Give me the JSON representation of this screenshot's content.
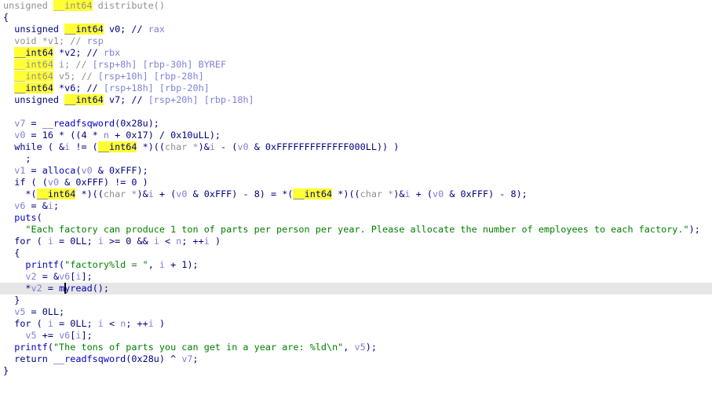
{
  "view": "pseudocode",
  "current_line": 24,
  "colors": {
    "code": "#000080",
    "variable": "#8080d8",
    "string": "#008000",
    "function": "#0000c0",
    "highlight": "#ffff33",
    "current_line": "#e6e6e6"
  },
  "lines": [
    {
      "indent": 0,
      "tokens": [
        [
          "g",
          "unsigned "
        ],
        [
          "hg",
          "__int64"
        ],
        [
          "g",
          " distribute()"
        ]
      ]
    },
    {
      "indent": 0,
      "tokens": [
        [
          "n",
          "{"
        ]
      ]
    },
    {
      "indent": 1,
      "tokens": [
        [
          "n",
          "unsigned "
        ],
        [
          "h",
          "__int64"
        ],
        [
          "n",
          " v0; // "
        ],
        [
          "v",
          "rax"
        ]
      ]
    },
    {
      "indent": 1,
      "tokens": [
        [
          "g",
          "void *v1; // "
        ],
        [
          "v",
          "rsp"
        ]
      ]
    },
    {
      "indent": 1,
      "tokens": [
        [
          "h",
          "__int64"
        ],
        [
          "n",
          " *v2; // "
        ],
        [
          "v",
          "rbx"
        ]
      ]
    },
    {
      "indent": 1,
      "tokens": [
        [
          "hg",
          "__int64"
        ],
        [
          "g",
          " i; // "
        ],
        [
          "v",
          "[rsp+8h] [rbp-30h] BYREF"
        ]
      ]
    },
    {
      "indent": 1,
      "tokens": [
        [
          "hg",
          "__int64"
        ],
        [
          "g",
          " v5; // "
        ],
        [
          "v",
          "[rsp+10h] [rbp-28h]"
        ]
      ]
    },
    {
      "indent": 1,
      "tokens": [
        [
          "h",
          "__int64"
        ],
        [
          "n",
          " *v6; // "
        ],
        [
          "v",
          "[rsp+18h] [rbp-20h]"
        ]
      ]
    },
    {
      "indent": 1,
      "tokens": [
        [
          "n",
          "unsigned "
        ],
        [
          "h",
          "__int64"
        ],
        [
          "n",
          " v7; // "
        ],
        [
          "v",
          "[rsp+20h] [rbp-18h]"
        ]
      ]
    },
    {
      "indent": 0,
      "tokens": []
    },
    {
      "indent": 1,
      "tokens": [
        [
          "v",
          "v7"
        ],
        [
          "n",
          " = "
        ],
        [
          "f",
          "__readfsqword"
        ],
        [
          "n",
          "(0x28u);"
        ]
      ]
    },
    {
      "indent": 1,
      "tokens": [
        [
          "v",
          "v0"
        ],
        [
          "n",
          " = 16 * ((4 * "
        ],
        [
          "v",
          "n"
        ],
        [
          "n",
          " + 0x17) / 0x10uLL);"
        ]
      ]
    },
    {
      "indent": 1,
      "tokens": [
        [
          "n",
          "while ( &"
        ],
        [
          "v",
          "i"
        ],
        [
          "n",
          " != ("
        ],
        [
          "h",
          "__int64"
        ],
        [
          "n",
          " *)(("
        ],
        [
          "g",
          "char *"
        ],
        [
          "n",
          ")&"
        ],
        [
          "v",
          "i"
        ],
        [
          "n",
          " - ("
        ],
        [
          "v",
          "v0"
        ],
        [
          "n",
          " & 0xFFFFFFFFFFFFF000LL)) )"
        ]
      ]
    },
    {
      "indent": 2,
      "tokens": [
        [
          "n",
          ";"
        ]
      ]
    },
    {
      "indent": 1,
      "tokens": [
        [
          "v",
          "v1"
        ],
        [
          "n",
          " = "
        ],
        [
          "f",
          "alloca"
        ],
        [
          "n",
          "("
        ],
        [
          "v",
          "v0"
        ],
        [
          "n",
          " & 0xFFF);"
        ]
      ]
    },
    {
      "indent": 1,
      "tokens": [
        [
          "n",
          "if ( ("
        ],
        [
          "v",
          "v0"
        ],
        [
          "n",
          " & 0xFFF) != 0 )"
        ]
      ]
    },
    {
      "indent": 2,
      "tokens": [
        [
          "n",
          "*("
        ],
        [
          "h",
          "__int64"
        ],
        [
          "n",
          " *)(("
        ],
        [
          "g",
          "char *"
        ],
        [
          "n",
          ")&"
        ],
        [
          "v",
          "i"
        ],
        [
          "n",
          " + ("
        ],
        [
          "v",
          "v0"
        ],
        [
          "n",
          " & 0xFFF) - 8) = *("
        ],
        [
          "h",
          "__int64"
        ],
        [
          "n",
          " *)(("
        ],
        [
          "g",
          "char *"
        ],
        [
          "n",
          ")&"
        ],
        [
          "v",
          "i"
        ],
        [
          "n",
          " + ("
        ],
        [
          "v",
          "v0"
        ],
        [
          "n",
          " & 0xFFF) - 8);"
        ]
      ]
    },
    {
      "indent": 1,
      "tokens": [
        [
          "v",
          "v6"
        ],
        [
          "n",
          " = &"
        ],
        [
          "v",
          "i"
        ],
        [
          "n",
          ";"
        ]
      ]
    },
    {
      "indent": 1,
      "tokens": [
        [
          "f",
          "puts"
        ],
        [
          "n",
          "("
        ]
      ]
    },
    {
      "indent": 2,
      "tokens": [
        [
          "s",
          "\"Each factory can produce 1 ton of parts per person per year. Please allocate the number of employees to each factory.\""
        ],
        [
          "n",
          ");"
        ]
      ]
    },
    {
      "indent": 1,
      "tokens": [
        [
          "n",
          "for ( "
        ],
        [
          "v",
          "i"
        ],
        [
          "n",
          " = 0LL; "
        ],
        [
          "v",
          "i"
        ],
        [
          "n",
          " >= 0 && "
        ],
        [
          "v",
          "i"
        ],
        [
          "n",
          " < "
        ],
        [
          "v",
          "n"
        ],
        [
          "n",
          "; ++"
        ],
        [
          "v",
          "i"
        ],
        [
          "n",
          " )"
        ]
      ]
    },
    {
      "indent": 1,
      "tokens": [
        [
          "n",
          "{"
        ]
      ]
    },
    {
      "indent": 2,
      "tokens": [
        [
          "f",
          "printf"
        ],
        [
          "n",
          "("
        ],
        [
          "s",
          "\"factory%ld = \""
        ],
        [
          "n",
          ", "
        ],
        [
          "v",
          "i"
        ],
        [
          "n",
          " + 1);"
        ]
      ]
    },
    {
      "indent": 2,
      "tokens": [
        [
          "v",
          "v2"
        ],
        [
          "n",
          " = &"
        ],
        [
          "v",
          "v6"
        ],
        [
          "n",
          "["
        ],
        [
          "v",
          "i"
        ],
        [
          "n",
          "];"
        ]
      ]
    },
    {
      "indent": 2,
      "tokens": [
        [
          "n",
          "*"
        ],
        [
          "v",
          "v2"
        ],
        [
          "n",
          " = "
        ],
        [
          "f",
          "m"
        ],
        [
          "caret",
          ""
        ],
        [
          "f",
          "yread"
        ],
        [
          "n",
          "();"
        ]
      ]
    },
    {
      "indent": 1,
      "tokens": [
        [
          "n",
          "}"
        ]
      ]
    },
    {
      "indent": 1,
      "tokens": [
        [
          "v",
          "v5"
        ],
        [
          "n",
          " = 0LL;"
        ]
      ]
    },
    {
      "indent": 1,
      "tokens": [
        [
          "n",
          "for ( "
        ],
        [
          "v",
          "i"
        ],
        [
          "n",
          " = 0LL; "
        ],
        [
          "v",
          "i"
        ],
        [
          "n",
          " < "
        ],
        [
          "v",
          "n"
        ],
        [
          "n",
          "; ++"
        ],
        [
          "v",
          "i"
        ],
        [
          "n",
          " )"
        ]
      ]
    },
    {
      "indent": 2,
      "tokens": [
        [
          "v",
          "v5"
        ],
        [
          "n",
          " += "
        ],
        [
          "v",
          "v6"
        ],
        [
          "n",
          "["
        ],
        [
          "v",
          "i"
        ],
        [
          "n",
          "];"
        ]
      ]
    },
    {
      "indent": 1,
      "tokens": [
        [
          "f",
          "printf"
        ],
        [
          "n",
          "("
        ],
        [
          "s",
          "\"The tons of parts you can get in a year are: %ld\\n\""
        ],
        [
          "n",
          ", "
        ],
        [
          "v",
          "v5"
        ],
        [
          "n",
          ");"
        ]
      ]
    },
    {
      "indent": 1,
      "tokens": [
        [
          "n",
          "return "
        ],
        [
          "f",
          "__readfsqword"
        ],
        [
          "n",
          "(0x28u) ^ "
        ],
        [
          "v",
          "v7"
        ],
        [
          "n",
          ";"
        ]
      ]
    },
    {
      "indent": 0,
      "tokens": [
        [
          "n",
          "}"
        ]
      ]
    }
  ]
}
